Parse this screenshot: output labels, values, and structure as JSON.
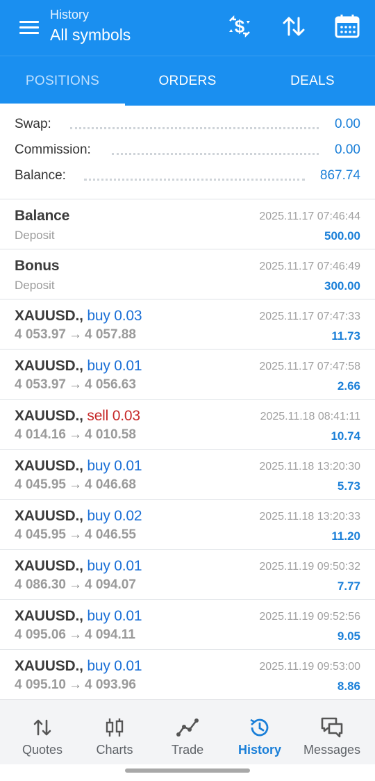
{
  "header": {
    "subtitle": "History",
    "title": "All symbols",
    "icons": [
      "menu-icon",
      "currency-exchange-icon",
      "sort-icon",
      "calendar-icon"
    ]
  },
  "tabs": [
    {
      "label": "POSITIONS",
      "active": true
    },
    {
      "label": "ORDERS",
      "active": false
    },
    {
      "label": "DEALS",
      "active": false
    }
  ],
  "summary": {
    "swap": {
      "label": "Swap:",
      "value": "0.00"
    },
    "commission": {
      "label": "Commission:",
      "value": "0.00"
    },
    "balance": {
      "label": "Balance:",
      "value": "867.74"
    }
  },
  "deals": [
    {
      "symbol": "Balance",
      "side": "",
      "side_type": "",
      "line2": "Deposit",
      "line2_type": "plain",
      "time": "2025.11.17 07:46:44",
      "profit": "500.00"
    },
    {
      "symbol": "Bonus",
      "side": "",
      "side_type": "",
      "line2": "Deposit",
      "line2_type": "plain",
      "time": "2025.11.17 07:46:49",
      "profit": "300.00"
    },
    {
      "symbol": "XAUUSD.,",
      "side": "buy 0.03",
      "side_type": "buy",
      "open": "4 053.97",
      "close": "4 057.88",
      "time": "2025.11.17 07:47:33",
      "profit": "11.73"
    },
    {
      "symbol": "XAUUSD.,",
      "side": "buy 0.01",
      "side_type": "buy",
      "open": "4 053.97",
      "close": "4 056.63",
      "time": "2025.11.17 07:47:58",
      "profit": "2.66"
    },
    {
      "symbol": "XAUUSD.,",
      "side": "sell 0.03",
      "side_type": "sell",
      "open": "4 014.16",
      "close": "4 010.58",
      "time": "2025.11.18 08:41:11",
      "profit": "10.74"
    },
    {
      "symbol": "XAUUSD.,",
      "side": "buy 0.01",
      "side_type": "buy",
      "open": "4 045.95",
      "close": "4 046.68",
      "time": "2025.11.18 13:20:30",
      "profit": "5.73"
    },
    {
      "symbol": "XAUUSD.,",
      "side": "buy 0.02",
      "side_type": "buy",
      "open": "4 045.95",
      "close": "4 046.55",
      "time": "2025.11.18 13:20:33",
      "profit": "11.20"
    },
    {
      "symbol": "XAUUSD.,",
      "side": "buy 0.01",
      "side_type": "buy",
      "open": "4 086.30",
      "close": "4 094.07",
      "time": "2025.11.19 09:50:32",
      "profit": "7.77"
    },
    {
      "symbol": "XAUUSD.,",
      "side": "buy 0.01",
      "side_type": "buy",
      "open": "4 095.06",
      "close": "4 094.11",
      "time": "2025.11.19 09:52:56",
      "profit": "9.05"
    },
    {
      "symbol": "XAUUSD.,",
      "side": "buy 0.01",
      "side_type": "buy",
      "open": "4 095.10",
      "close": "4 093.96",
      "time": "2025.11.19 09:53:00",
      "profit": "8.86"
    }
  ],
  "arrow_glyph": "→",
  "bottom_nav": [
    {
      "label": "Quotes",
      "icon": "quotes-icon",
      "active": false
    },
    {
      "label": "Charts",
      "icon": "charts-icon",
      "active": false
    },
    {
      "label": "Trade",
      "icon": "trade-icon",
      "active": false
    },
    {
      "label": "History",
      "icon": "history-icon",
      "active": true
    },
    {
      "label": "Messages",
      "icon": "messages-icon",
      "active": false
    }
  ],
  "colors": {
    "primary": "#1a8ff0",
    "buy": "#1a6fd6",
    "sell": "#c62828",
    "profit": "#1a7fd8"
  }
}
